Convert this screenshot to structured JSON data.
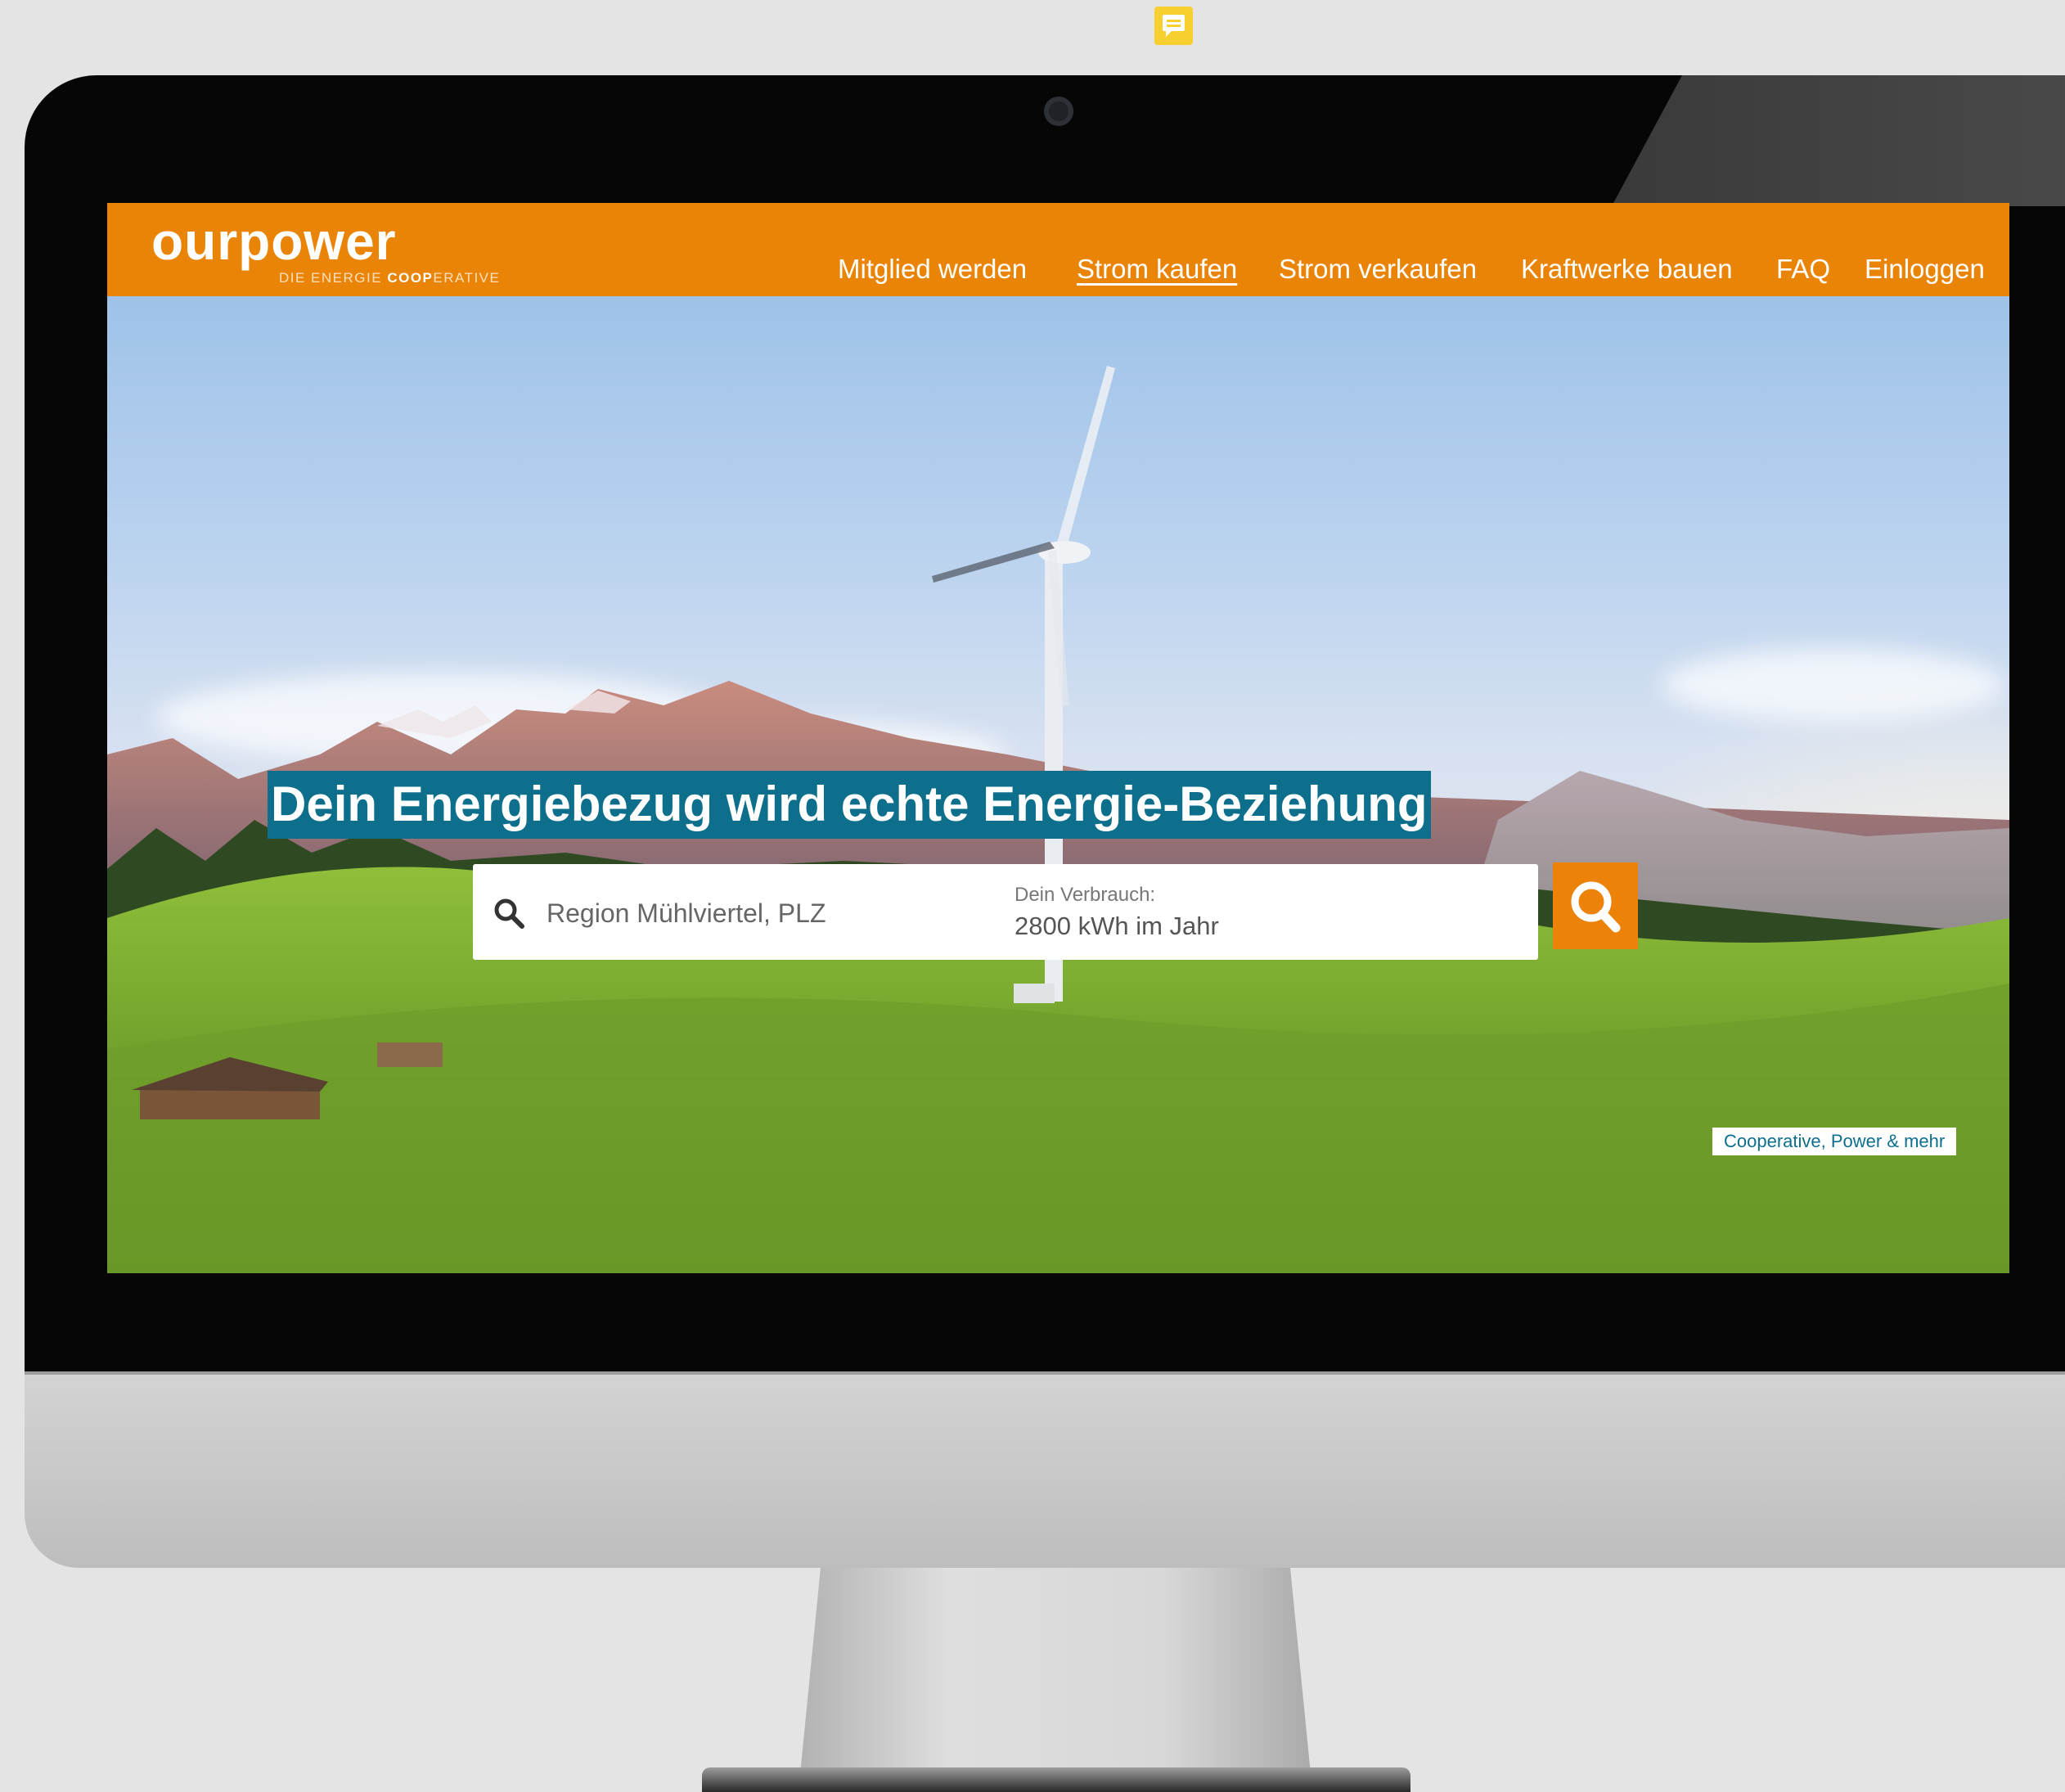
{
  "toolbar": {
    "note_icon": "note-icon"
  },
  "brand": {
    "logo_text": "ourpower",
    "tagline_prefix": "DIE ENERGIE ",
    "tagline_bold": "COOP",
    "tagline_suffix": "ERATIVE",
    "accent_color": "#ea8407",
    "teal_color": "#0e6f8c"
  },
  "nav": {
    "items": [
      {
        "label": "Mitglied werden",
        "active": false
      },
      {
        "label": "Strom kaufen",
        "active": true
      },
      {
        "label": "Strom verkaufen",
        "active": false
      },
      {
        "label": "Kraftwerke bauen",
        "active": false
      },
      {
        "label": "FAQ",
        "active": false
      },
      {
        "label": "Einloggen",
        "active": false
      }
    ]
  },
  "hero": {
    "headline": "Dein Energiebezug wird echte Energie-Beziehung",
    "search": {
      "placeholder": "Region Mühlviertel, PLZ",
      "usage_label": "Dein Verbrauch:",
      "usage_value": "2800 kWh im Jahr",
      "icon": "search-icon",
      "button_icon": "search-icon"
    },
    "caption": "Cooperative, Power & mehr"
  }
}
